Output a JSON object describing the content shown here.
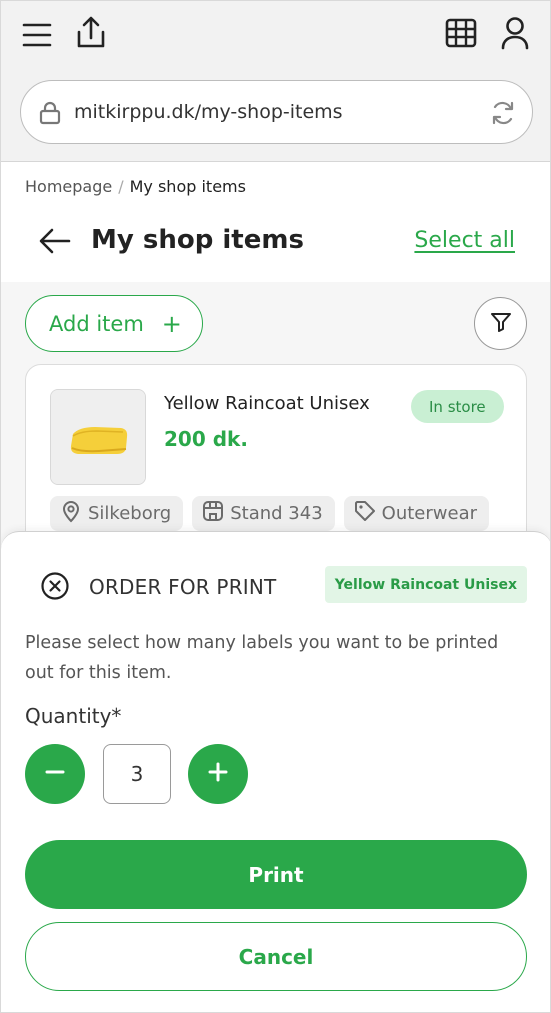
{
  "browser": {
    "url": "mitkirppu.dk/my-shop-items"
  },
  "breadcrumb": {
    "home": "Homepage",
    "separator": "/",
    "current": "My shop items"
  },
  "header": {
    "title": "My shop items",
    "select_all_label": "Select all"
  },
  "toolbar": {
    "add_item_label": "Add item",
    "add_item_icon": "+"
  },
  "product": {
    "name": "Yellow Raincoat Unisex",
    "price": "200 dk.",
    "status": "In store",
    "tags": [
      {
        "icon": "location-pin-icon",
        "label": "Silkeborg"
      },
      {
        "icon": "store-icon",
        "label": "Stand 343"
      },
      {
        "icon": "tag-icon",
        "label": "Outerwear"
      }
    ]
  },
  "sheet": {
    "title": "ORDER FOR PRINT",
    "item_badge": "Yellow Raincoat Unisex",
    "instructions": "Please select how many labels you want to be printed out for this item.",
    "quantity_label": "Quantity*",
    "quantity_value": "3",
    "print_label": "Print",
    "cancel_label": "Cancel"
  },
  "colors": {
    "brand_green": "#2aa84a",
    "badge_green_bg": "#c9efd3",
    "browser_bg": "#f2f2f2"
  }
}
